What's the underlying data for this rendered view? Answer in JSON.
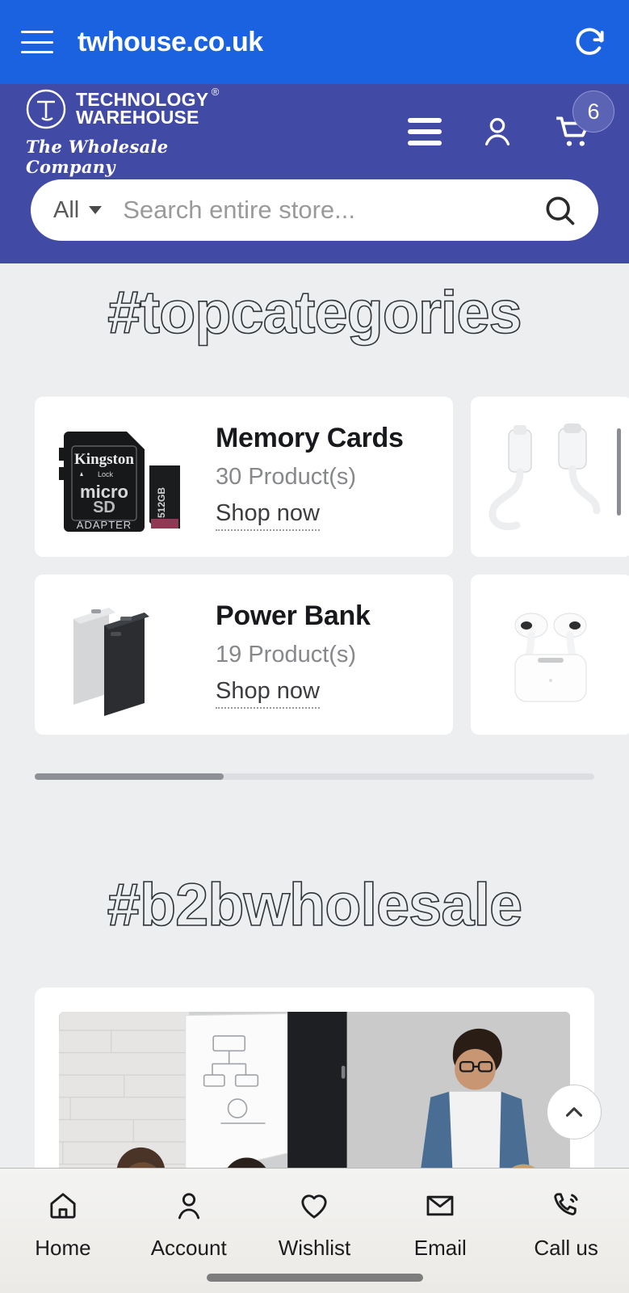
{
  "browser": {
    "url": "twhouse.co.uk",
    "menu_icon": "hamburger-icon",
    "refresh_icon": "refresh-icon"
  },
  "header": {
    "logo": {
      "line1": "TECHNOLOGY",
      "line2": "WAREHOUSE",
      "registered": "®",
      "tagline": "The Wholesale Company"
    },
    "menu_icon": "hamburger-icon",
    "account_icon": "account-icon",
    "cart_icon": "cart-icon",
    "cart_count": "6",
    "colors": {
      "header_bg": "#414aa5",
      "browser_bg": "#1a62e0",
      "page_bg": "#eceef0"
    }
  },
  "search": {
    "category": "All",
    "placeholder": "Search entire store...",
    "value": "",
    "submit_icon": "search-icon"
  },
  "sections": {
    "top_categories_heading": "#topcategories",
    "b2b_heading": "#b2bwholesale"
  },
  "categories": [
    {
      "title": "Memory Cards",
      "count": "30 Product(s)",
      "cta": "Shop now",
      "image": "kingston-microsd-card"
    },
    {
      "title": "Power Bank",
      "count": "19 Product(s)",
      "cta": "Shop now",
      "image": "power-bank"
    },
    {
      "title": "",
      "count": "",
      "cta": "",
      "image": "lightning-usbc-cable"
    },
    {
      "title": "",
      "count": "",
      "cta": "",
      "image": "airpods-pro-case"
    }
  ],
  "carousel": {
    "scrollbar_position": "30%"
  },
  "b2b": {
    "image": "business-meeting-photo"
  },
  "scroll_top_button": {
    "icon": "chevron-up-icon"
  },
  "bottom_nav": [
    {
      "label": "Home",
      "icon": "home-icon"
    },
    {
      "label": "Account",
      "icon": "person-icon"
    },
    {
      "label": "Wishlist",
      "icon": "heart-icon"
    },
    {
      "label": "Email",
      "icon": "envelope-icon"
    },
    {
      "label": "Call us",
      "icon": "phone-icon"
    }
  ]
}
